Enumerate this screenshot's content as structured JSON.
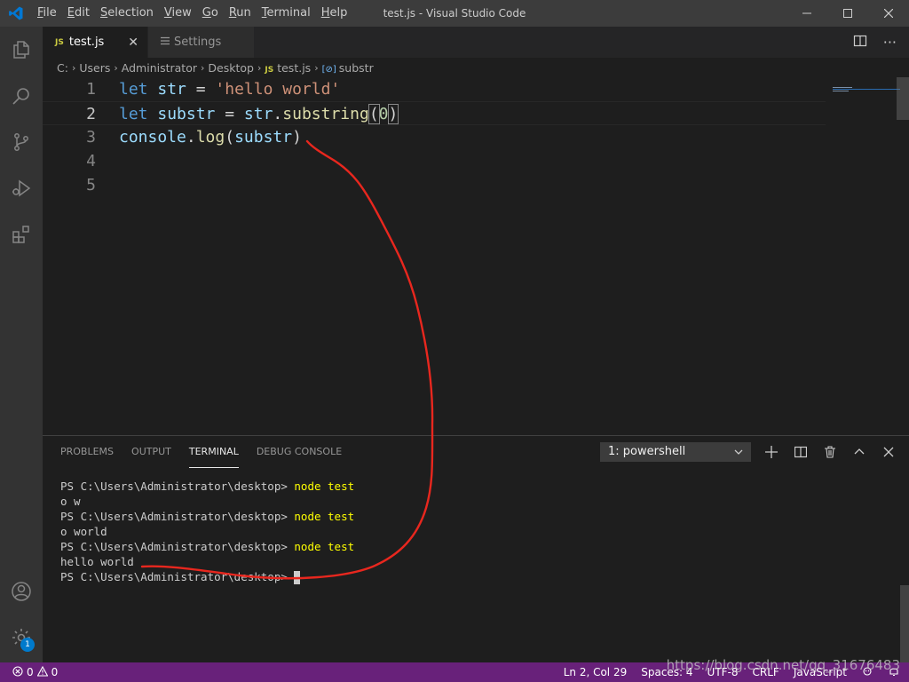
{
  "titlebar": {
    "menu": [
      "File",
      "Edit",
      "Selection",
      "View",
      "Go",
      "Run",
      "Terminal",
      "Help"
    ],
    "menu_mnemonics": [
      "F",
      "E",
      "S",
      "V",
      "G",
      "R",
      "T",
      "H"
    ],
    "title": "test.js - Visual Studio Code"
  },
  "activitybar": {
    "icons": [
      "files-icon",
      "search-icon",
      "source-control-icon",
      "run-debug-icon",
      "extensions-icon"
    ],
    "bottom_icons": [
      "accounts-icon",
      "manage-gear-icon"
    ],
    "manage_badge": "1"
  },
  "tabs": [
    {
      "icon": "JS",
      "label": "test.js",
      "active": true
    },
    {
      "icon": "settings-icon",
      "label": "Settings",
      "active": false
    }
  ],
  "breadcrumb": [
    "C:",
    "Users",
    "Administrator",
    "Desktop",
    "test.js",
    "substr"
  ],
  "breadcrumb_file_icon": "JS",
  "editor": {
    "line_numbers": [
      "1",
      "2",
      "3",
      "4",
      "5"
    ],
    "current_line": 2,
    "lines": [
      [
        {
          "t": "let",
          "c": "kw"
        },
        {
          "t": " ",
          "c": "op"
        },
        {
          "t": "str",
          "c": "var"
        },
        {
          "t": " = ",
          "c": "op"
        },
        {
          "t": "'hello world'",
          "c": "str"
        }
      ],
      [
        {
          "t": "let",
          "c": "kw"
        },
        {
          "t": " ",
          "c": "op"
        },
        {
          "t": "substr",
          "c": "var"
        },
        {
          "t": " = ",
          "c": "op"
        },
        {
          "t": "str",
          "c": "var"
        },
        {
          "t": ".",
          "c": "op"
        },
        {
          "t": "substring",
          "c": "fn"
        },
        {
          "t": "(",
          "c": "op bracket"
        },
        {
          "t": "0",
          "c": "num"
        },
        {
          "t": ")",
          "c": "op bracket"
        }
      ],
      [
        {
          "t": "console",
          "c": "var"
        },
        {
          "t": ".",
          "c": "op"
        },
        {
          "t": "log",
          "c": "fn"
        },
        {
          "t": "(",
          "c": "op"
        },
        {
          "t": "substr",
          "c": "var"
        },
        {
          "t": ")",
          "c": "op"
        }
      ],
      [],
      []
    ]
  },
  "panel": {
    "tabs": [
      "PROBLEMS",
      "OUTPUT",
      "TERMINAL",
      "DEBUG CONSOLE"
    ],
    "active_tab": "TERMINAL",
    "terminal_select": "1: powershell",
    "actions": [
      "add-terminal-icon",
      "split-terminal-icon",
      "kill-terminal-icon",
      "maximize-panel-icon",
      "close-panel-icon"
    ],
    "terminal_lines": [
      {
        "prompt": "PS C:\\Users\\Administrator\\desktop> ",
        "cmd": "node test"
      },
      {
        "output": "o w"
      },
      {
        "prompt": "PS C:\\Users\\Administrator\\desktop> ",
        "cmd": "node test"
      },
      {
        "output": "o world"
      },
      {
        "prompt": "PS C:\\Users\\Administrator\\desktop> ",
        "cmd": "node test"
      },
      {
        "output": "hello world"
      },
      {
        "prompt": "PS C:\\Users\\Administrator\\desktop> ",
        "cmd": "",
        "cursor": true
      }
    ]
  },
  "statusbar": {
    "errors": "0",
    "warnings": "0",
    "right": [
      "Ln 2, Col 29",
      "Spaces: 4",
      "UTF-8",
      "CRLF",
      "JavaScript"
    ],
    "right_icons": [
      "feedback-icon",
      "notifications-icon"
    ]
  },
  "watermark": "https://blog.csdn.net/qq_31676483",
  "colors": {
    "statusbar": "#68217a",
    "annotation": "#e8271e",
    "vscode_blue": "#0078d4"
  }
}
